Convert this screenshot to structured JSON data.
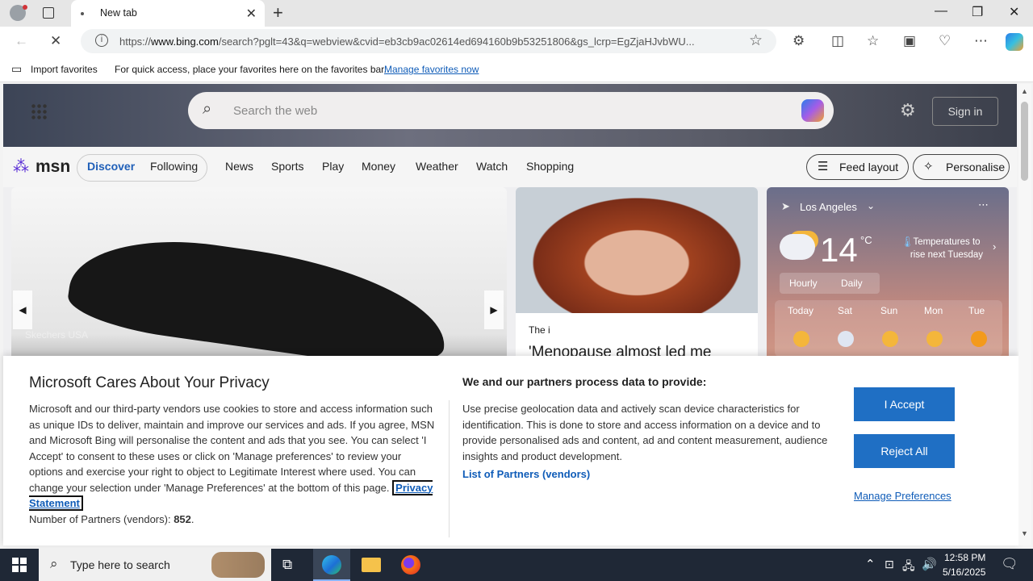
{
  "browser": {
    "tab_title": "New tab",
    "url_host": "www.bing.com",
    "url_prefix": "https://",
    "url_rest": "/search?pglt=43&q=webview&cvid=eb3cb9ac02614ed694160b9b53251806&gs_lcrp=EgZjaHJvbWU...",
    "favbar": {
      "import": "Import favorites",
      "hint": "For quick access, place your favorites here on the favorites bar.",
      "manage_link": "Manage favorites now"
    }
  },
  "msn": {
    "search_placeholder": "Search the web",
    "sign_in": "Sign in",
    "logo": "msn",
    "nav": [
      "Discover",
      "Following",
      "News",
      "Sports",
      "Play",
      "Money",
      "Weather",
      "Watch",
      "Shopping"
    ],
    "feed_layout": "Feed layout",
    "personalise": "Personalise",
    "card1_source": "Skechers USA",
    "card2_source": "The i",
    "card2_headline": "'Menopause almost led me",
    "weather": {
      "location": "Los Angeles",
      "temp": "14",
      "unit": "°C",
      "note": "Temperatures to rise next Tuesday",
      "tab_hourly": "Hourly",
      "tab_daily": "Daily",
      "days": [
        "Today",
        "Sat",
        "Sun",
        "Mon",
        "Tue"
      ]
    }
  },
  "consent": {
    "title": "Microsoft Cares About Your Privacy",
    "body": "Microsoft and our third-party vendors use cookies to store and access information such as unique IDs to deliver, maintain and improve our services and ads. If you agree, MSN and Microsoft Bing will personalise the content and ads that you see. You can select 'I Accept' to consent to these uses or click on 'Manage preferences' to review your options and exercise your right to object to Legitimate Interest where used.  You can change your selection under 'Manage Preferences' at the bottom of this page.",
    "privacy_link": "Privacy Statement",
    "partners_label": "Number of Partners (vendors):",
    "partners_count": "852",
    "right_title": "We and our partners process data to provide:",
    "right_body": "Use precise geolocation data and actively scan device characteristics for identification. This is done to store and access information on a device and to provide personalised ads and content, ad and content measurement, audience insights and product development.",
    "partners_link": "List of Partners (vendors)",
    "accept": "I Accept",
    "reject": "Reject All",
    "manage": "Manage Preferences"
  },
  "taskbar": {
    "search_placeholder": "Type here to search",
    "time": "12:58 PM",
    "date": "5/16/2025"
  },
  "colors": {
    "accent": "#1f6fc4",
    "taskbar": "#1f2836"
  }
}
